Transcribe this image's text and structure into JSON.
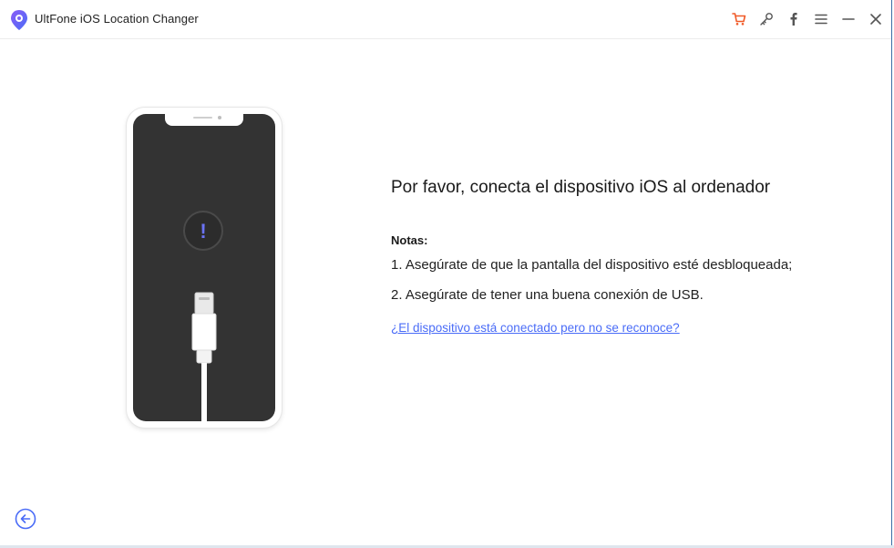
{
  "app": {
    "title": "UltFone iOS Location Changer",
    "logo_icon": "location-pin-icon"
  },
  "toolbar": {
    "buttons": [
      {
        "name": "cart-button",
        "icon": "cart-icon",
        "color": "#f05a28"
      },
      {
        "name": "register-button",
        "icon": "key-icon",
        "color": "#555555"
      },
      {
        "name": "facebook-button",
        "icon": "facebook-icon",
        "color": "#555555"
      },
      {
        "name": "menu-button",
        "icon": "menu-icon",
        "color": "#555555"
      },
      {
        "name": "minimize-button",
        "icon": "minimize-icon",
        "color": "#555555"
      },
      {
        "name": "close-button",
        "icon": "close-icon",
        "color": "#555555"
      }
    ]
  },
  "main": {
    "heading": "Por favor, conecta el dispositivo iOS al ordenador",
    "notes_label": "Notas:",
    "notes": [
      "1. Asegúrate de que la pantalla del dispositivo esté desbloqueada;",
      "2. Asegúrate de tener una buena conexión de USB."
    ],
    "help_link": "¿El dispositivo está conectado pero no se reconoce?",
    "alert_symbol": "!"
  },
  "colors": {
    "accent": "#4a6cf7",
    "alert": "#6b73f5",
    "cart": "#f05a28",
    "phone_screen": "#333333"
  }
}
